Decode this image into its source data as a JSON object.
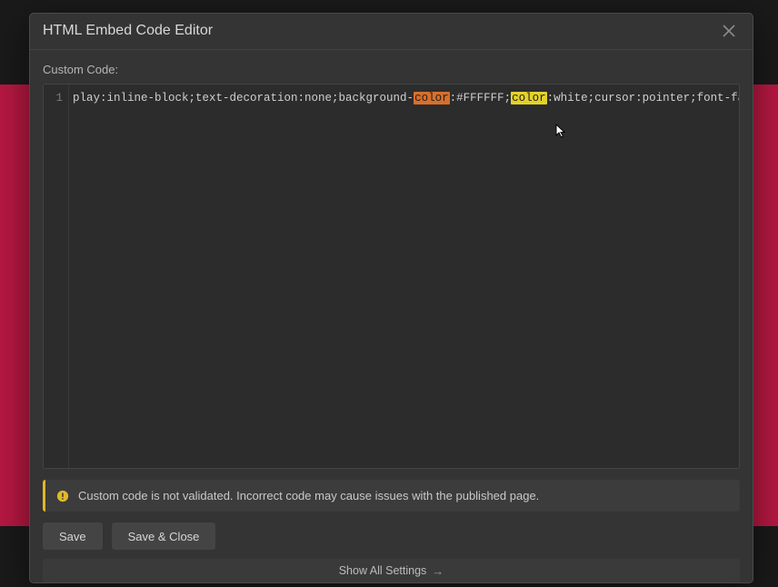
{
  "modal": {
    "title": "HTML Embed Code Editor",
    "field_label": "Custom Code:"
  },
  "code": {
    "line_number": "1",
    "seg_a": "play:inline-block;text-decoration:none;background-",
    "seg_hl1": "color",
    "seg_b": ":#FFFFFF;",
    "seg_hl2": "color",
    "seg_c": ":white;cursor:pointer;font-family:"
  },
  "warning": {
    "text": "Custom code is not validated. Incorrect code may cause issues with the published page."
  },
  "buttons": {
    "save": "Save",
    "save_close": "Save & Close"
  },
  "footer": {
    "show_all": "Show All Settings"
  }
}
